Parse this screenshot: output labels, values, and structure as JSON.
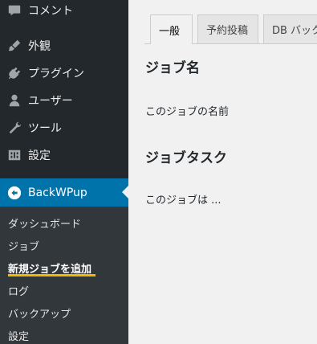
{
  "sidebar": {
    "items": [
      {
        "label": "コメント",
        "icon": "comment-icon"
      },
      {
        "label": "外観",
        "icon": "appearance-brush-icon"
      },
      {
        "label": "プラグイン",
        "icon": "plugin-icon"
      },
      {
        "label": "ユーザー",
        "icon": "user-icon"
      },
      {
        "label": "ツール",
        "icon": "wrench-icon"
      },
      {
        "label": "設定",
        "icon": "settings-icon"
      }
    ],
    "active": {
      "label": "BackWPup",
      "icon": "backwpup-logo-icon"
    },
    "submenu": [
      {
        "label": "ダッシュボード"
      },
      {
        "label": "ジョブ"
      },
      {
        "label": "新規ジョブを追加",
        "current": true
      },
      {
        "label": "ログ"
      },
      {
        "label": "バックアップ"
      },
      {
        "label": "設定"
      }
    ]
  },
  "tabs": [
    {
      "label": "一般",
      "active": true
    },
    {
      "label": "予約投稿"
    },
    {
      "label": "DB バック"
    }
  ],
  "main": {
    "job_name_heading": "ジョブ名",
    "job_name_label": "このジョブの名前",
    "job_tasks_heading": "ジョブタスク",
    "job_tasks_label": "このジョブは ..."
  },
  "colors": {
    "sidebar_bg": "#23282d",
    "submenu_bg": "#32373c",
    "active_bg": "#0073aa",
    "highlight_underline": "#f5b800",
    "content_bg": "#f1f1f1"
  }
}
